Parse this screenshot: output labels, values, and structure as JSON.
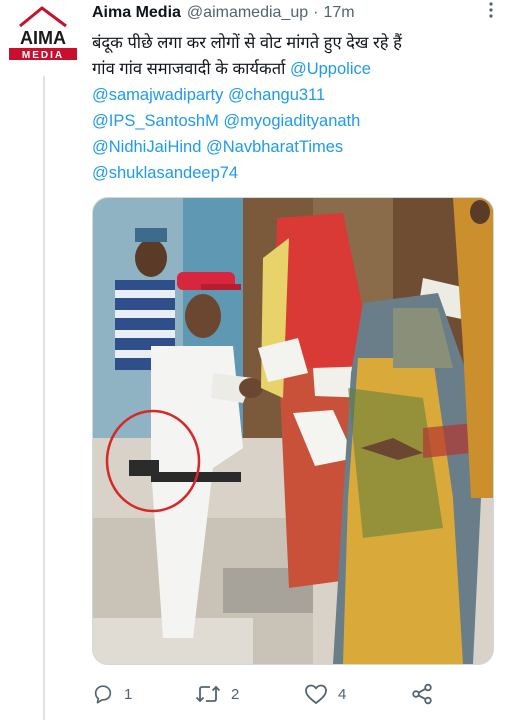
{
  "tweet": {
    "avatar_text_top": "AIMA",
    "avatar_text_bottom": "MEDIA",
    "author": "Aima Media",
    "handle": "@aimamedia_up",
    "separator": "·",
    "time": "17m",
    "more_icon": "more-vertical-icon",
    "text_line1": "बंदूक पीछे लगा कर लोगों से वोट मांगते हुए देख रहे हैं",
    "text_line2_prefix": "गांव गांव समाजवादी के कार्यकर्ता ",
    "mentions": {
      "m1": "@Uppolice",
      "m2": "@samajwadiparty",
      "m3": "@changu311",
      "m4": "@IPS_SantoshM",
      "m5": "@myogiadityanath",
      "m6": "@NidhiJaiHind",
      "m7": "@NavbharatTimes",
      "m8": "@shuklasandeep74"
    }
  },
  "actions": {
    "reply_icon": "reply-icon",
    "reply_count": "1",
    "retweet_icon": "retweet-icon",
    "retweet_count": "2",
    "like_icon": "heart-icon",
    "like_count": "4",
    "share_icon": "share-icon"
  },
  "colors": {
    "link": "#1d9bf0",
    "secondary_text": "#536471",
    "annotation_circle": "#d62828",
    "avatar_red": "#c8102e"
  }
}
